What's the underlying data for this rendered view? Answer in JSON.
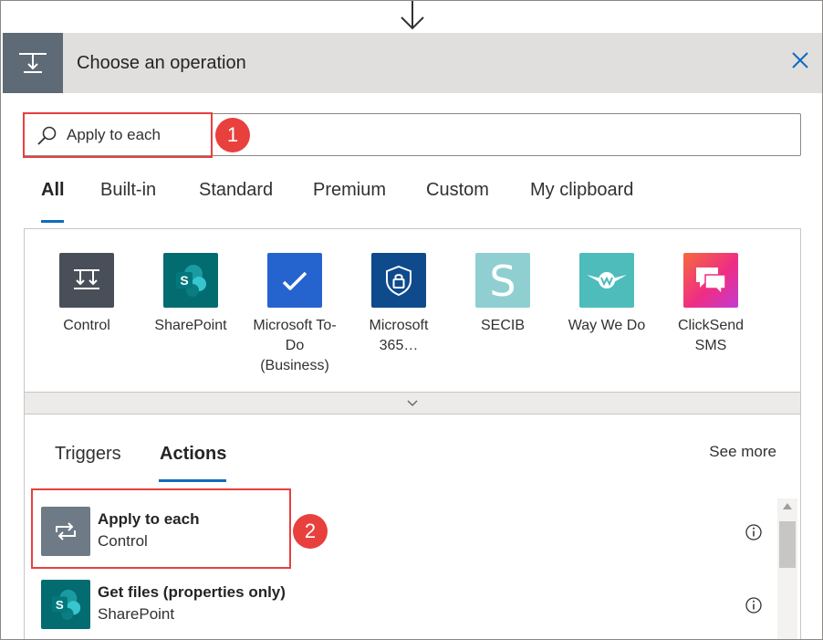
{
  "header": {
    "title": "Choose an operation",
    "icon": "operation-icon",
    "close_icon": "close-icon"
  },
  "search": {
    "value": "Apply to each",
    "icon": "search-icon"
  },
  "annotations": {
    "step1": "1",
    "step2": "2"
  },
  "tabs": [
    {
      "label": "All",
      "active": true
    },
    {
      "label": "Built-in"
    },
    {
      "label": "Standard"
    },
    {
      "label": "Premium"
    },
    {
      "label": "Custom"
    },
    {
      "label": "My clipboard"
    }
  ],
  "connectors": [
    {
      "label": "Control",
      "color": "#484f58",
      "icon": "control-icon"
    },
    {
      "label": "SharePoint",
      "color": "#036c70",
      "icon": "sharepoint-icon"
    },
    {
      "label": "Microsoft To-Do (Business)",
      "color": "#2564cf",
      "icon": "todo-check-icon"
    },
    {
      "label": "Microsoft 365…",
      "color": "#0f4a8c",
      "icon": "shield-lock-icon"
    },
    {
      "label": "SECIB",
      "color": "#8fcfd1",
      "icon": "secib-s-icon"
    },
    {
      "label": "Way We Do",
      "color": "#4dbcbb",
      "icon": "waywedo-wings-icon"
    },
    {
      "label": "ClickSend SMS",
      "color": "#f0467a",
      "icon": "chat-bubbles-icon"
    }
  ],
  "subtabs": [
    {
      "label": "Triggers"
    },
    {
      "label": "Actions",
      "active": true
    }
  ],
  "see_more": "See more",
  "actions": [
    {
      "name": "Apply to each",
      "connector": "Control",
      "color": "#6e7a86",
      "icon": "loop-icon"
    },
    {
      "name": "Get files (properties only)",
      "connector": "SharePoint",
      "color": "#036c70",
      "icon": "sharepoint-icon"
    }
  ],
  "colors": {
    "accent": "#0f6cbd",
    "annotation": "#e8403d"
  }
}
